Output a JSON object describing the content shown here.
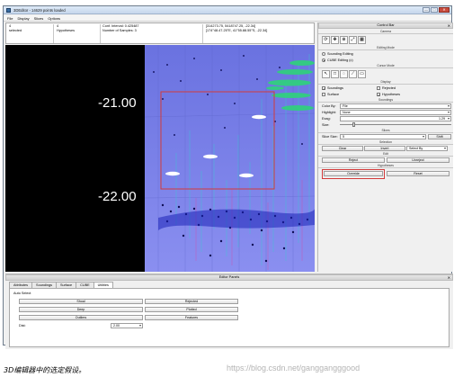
{
  "window": {
    "title": "3DEditor - 14629 points loaded",
    "controls": {
      "minimize": "—",
      "maximize": "□",
      "close": "✕"
    }
  },
  "menu": [
    "File",
    "Display",
    "Slices",
    "Options"
  ],
  "info": {
    "col1_line1": "4",
    "col1_line2": "selected",
    "col2_line1": "4",
    "col2_line2": "Hypotheses",
    "col3_line1": "Conf. Interval: 0.425487",
    "col3_line2": "Number of Samples: 3",
    "col4_line1": "[314273.75, 5418747.25, -22.34]",
    "col4_line2": "[174°48.47.25°E, 41°55.88.55°S, -22.34]"
  },
  "view": {
    "depth_labels": [
      "-21.00",
      "-22.00"
    ],
    "background_color": "#7b82e6"
  },
  "control_bar": {
    "title": "Control Bar",
    "camera": "Camera",
    "editing_mode": "Editing Mode",
    "sounding_editing": "Sounding Editing",
    "cube_editing": "CUBE Editing (c)",
    "cursor_mode": "Cursor Mode",
    "display": "Display",
    "soundings": "Soundings",
    "rejected": "Rejected",
    "surface": "Surface",
    "hypotheses": "Hypotheses",
    "soundings_section": "Soundings",
    "color_by_label": "Color By:",
    "color_by_value": "File",
    "highlight_label": "Highlight:",
    "highlight_value": "None",
    "exag_label": "Exag:",
    "exag_value": "1.29",
    "size_label": "Size:",
    "slices": "Slices",
    "slice_size_label": "Slice Size:",
    "slice_size_value": "5",
    "shift": "Shift",
    "selection": "Selection",
    "clear": "Clear",
    "invert": "Invert",
    "select_by": "Select By",
    "edit": "Edit",
    "reject": "Reject",
    "unreject": "Unreject",
    "hypotheses_section": "Hypotheses",
    "override": "Override",
    "reset": "Reset"
  },
  "editor_panels": {
    "title": "Editor Panels",
    "tabs": [
      "Attributes",
      "Soundings",
      "Surface",
      "CUBE",
      "Utilities"
    ],
    "active_tab": "Utilities",
    "auto_select": "Auto Select",
    "buttons": {
      "shoal": "Shoal",
      "rejected": "Rejected",
      "deep": "Deep",
      "plotted": "Plotted",
      "outliers": "Outliers",
      "features": "Features"
    },
    "dist_label": "Dist:",
    "dist_value": "2.00"
  },
  "caption": "3D编辑器中的选定假设。",
  "watermark": "https://blog.csdn.net/ganggangggood"
}
